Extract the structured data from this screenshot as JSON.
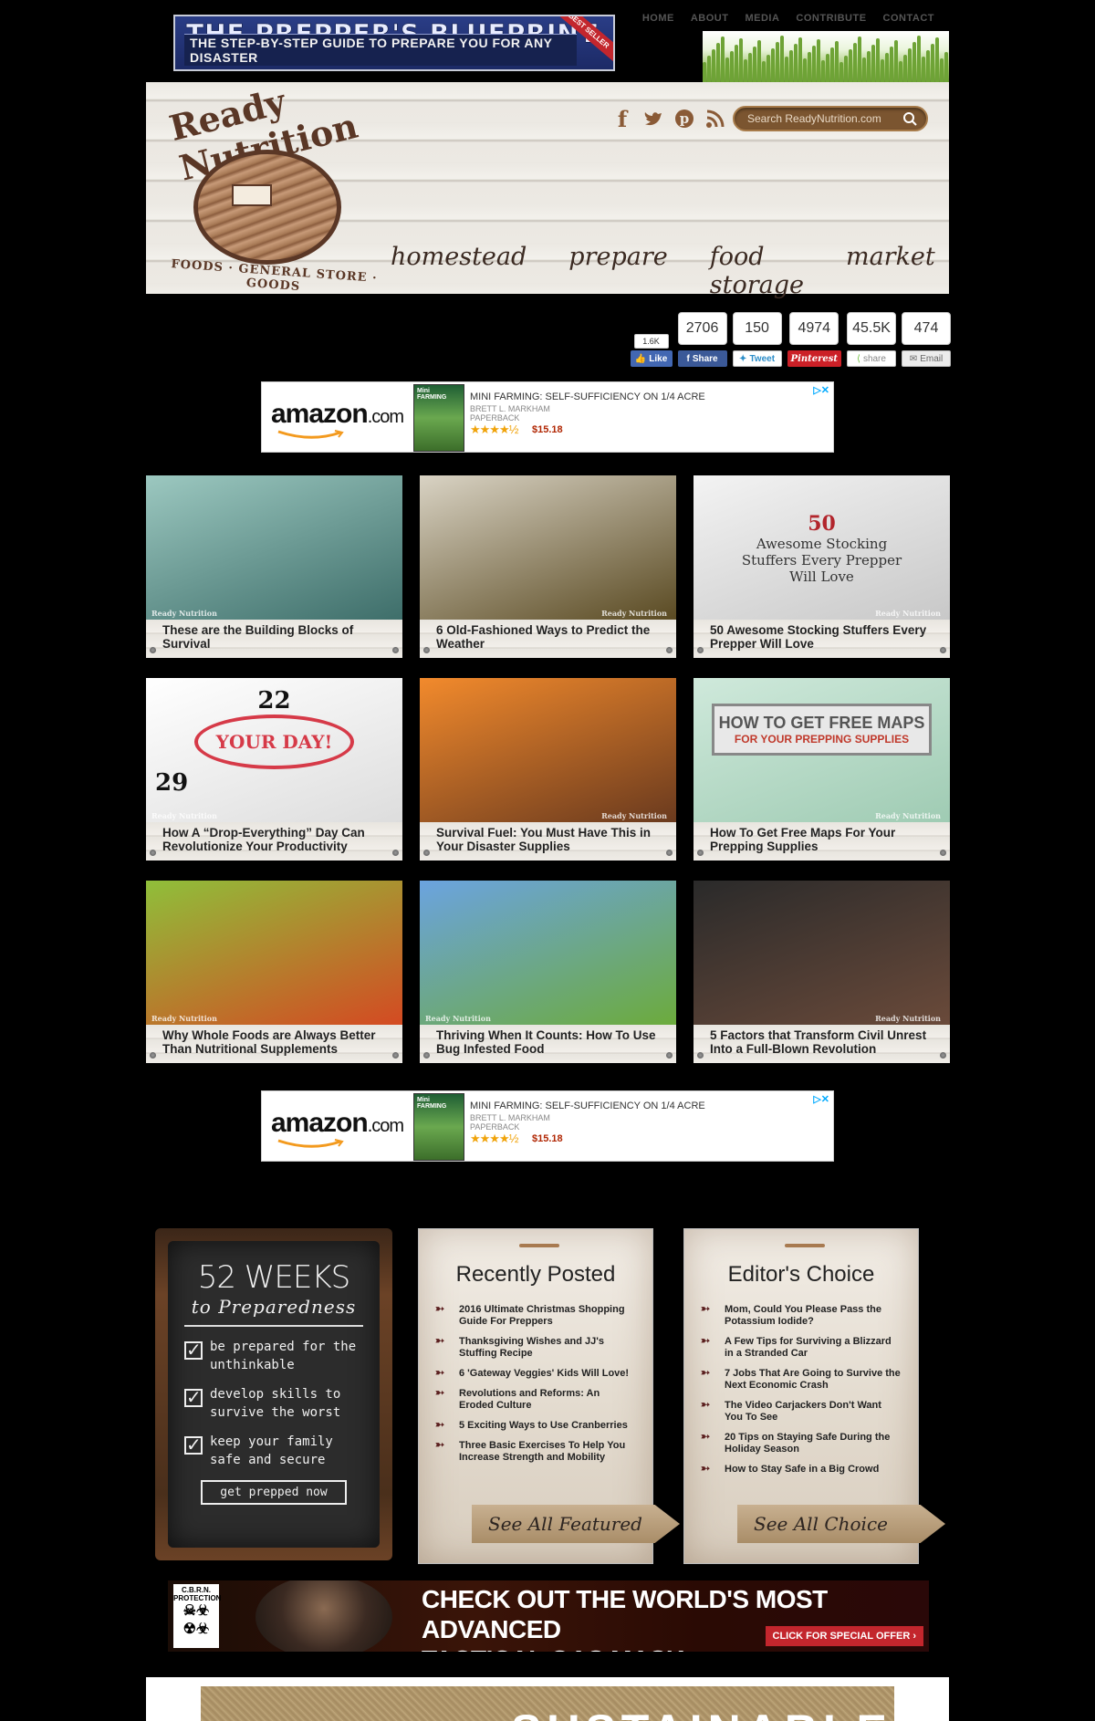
{
  "top_banner": {
    "title": "THE PREPPER'S BLUEPRINT",
    "subtitle": "THE STEP-BY-STEP GUIDE TO PREPARE YOU FOR ANY DISASTER",
    "ribbon": "BEST SELLER"
  },
  "top_nav": [
    "HOME",
    "ABOUT",
    "MEDIA",
    "CONTRIBUTE",
    "CONTACT"
  ],
  "header": {
    "logo_name": "Ready Nutrition",
    "logo_tagline": "FOODS · GENERAL STORE · GOODS",
    "social_icons": [
      "facebook-icon",
      "twitter-icon",
      "pinterest-icon",
      "rss-icon"
    ],
    "search_placeholder": "Search ReadyNutrition.com",
    "nav": [
      "homestead",
      "prepare",
      "food storage",
      "market"
    ]
  },
  "share_bar": {
    "like_count": "1.6K",
    "like_label": "Like",
    "buttons": [
      {
        "count": "2706",
        "label": "Share",
        "icon": "facebook-icon"
      },
      {
        "count": "150",
        "label": "Tweet",
        "icon": "twitter-icon"
      },
      {
        "count": "4974",
        "label": "Pinterest",
        "icon": "pinterest-icon"
      },
      {
        "count": "45.5K",
        "label": "share",
        "icon": "share-icon"
      },
      {
        "count": "474",
        "label": "Email",
        "icon": "email-icon"
      }
    ]
  },
  "amazon_ad": {
    "logo": "amazon",
    "logo_suffix": ".com",
    "book_cover_text": "Mini FARMING",
    "title": "MINI FARMING: SELF-SUFFICIENCY ON 1/4 ACRE",
    "author": "BRETT L. MARKHAM",
    "format": "PAPERBACK",
    "rating": 4.5,
    "stars": "★★★★½",
    "price": "$15.18",
    "choices_icon": "ad-choices-icon"
  },
  "watermark": "Ready Nutrition",
  "articles": [
    {
      "title": "These are the Building Blocks of Survival",
      "colors": [
        "#9cc8c0",
        "#3e6e6a"
      ]
    },
    {
      "title": "6 Old-Fashioned Ways to Predict the Weather",
      "colors": [
        "#d9d3c4",
        "#5a4a22"
      ]
    },
    {
      "title": "50 Awesome Stocking Stuffers Every Prepper Will Love",
      "colors": [
        "#f3f3f3",
        "#c8c8c8"
      ],
      "image_text_num": "50",
      "image_text": "Awesome Stocking Stuffers Every Prepper Will Love"
    },
    {
      "title": "How A “Drop-Everything” Day Can Revolutionize Your Productivity",
      "colors": [
        "#ffffff",
        "#dddddd"
      ],
      "image_text_num": "22",
      "image_text": "YOUR DAY!",
      "image_text_num2": "29"
    },
    {
      "title": "Survival Fuel: You Must Have This in Your Disaster Supplies",
      "colors": [
        "#f28a2c",
        "#6a3a1e"
      ]
    },
    {
      "title": "How To Get Free Maps For Your Prepping Supplies",
      "colors": [
        "#cfe9db",
        "#9fcbb3"
      ],
      "image_text": "HOW TO GET FREE MAPS",
      "image_text_sub": "FOR YOUR PREPPING SUPPLIES"
    },
    {
      "title": "Why Whole Foods are Always Better Than Nutritional Supplements",
      "colors": [
        "#8fbf3a",
        "#d44a22"
      ]
    },
    {
      "title": "Thriving When It Counts: How To Use Bug Infested Food",
      "colors": [
        "#6ba3e0",
        "#6cab3c"
      ]
    },
    {
      "title": "5 Factors that Transform Civil Unrest Into a Full-Blown Revolution",
      "colors": [
        "#2a2a2a",
        "#6a4a3a"
      ]
    }
  ],
  "weeks_widget": {
    "title": "52 WEEKS",
    "subtitle": "to Preparedness",
    "items": [
      "be prepared for the unthinkable",
      "develop skills to survive the worst",
      "keep your family safe and secure"
    ],
    "button": "get prepped now"
  },
  "recently_posted": {
    "heading": "Recently Posted",
    "items": [
      "2016 Ultimate Christmas Shopping Guide For Preppers",
      "Thanksgiving Wishes and JJ's Stuffing Recipe",
      "6 'Gateway Veggies' Kids Will Love!",
      "Revolutions and Reforms: An Eroded Culture",
      "5 Exciting Ways to Use Cranberries",
      "Three Basic Exercises To Help You Increase Strength and Mobility"
    ],
    "button": "See All Featured"
  },
  "editors_choice": {
    "heading": "Editor's Choice",
    "items": [
      "Mom, Could You Please Pass the Potassium Iodide?",
      "A Few Tips for Surviving a Blizzard in a Stranded Car",
      "7 Jobs That Are Going to Survive the Next Economic Crash",
      "The Video Carjackers Don't Want You To See",
      "20 Tips on Staying Safe During the Holiday Season",
      "How to Stay Safe in a Big Crowd"
    ],
    "button": "See All Choice"
  },
  "gas_banner": {
    "badge": "C.B.R.N. PROTECTION",
    "headline_line1": "CHECK OUT THE WORLD'S MOST ADVANCED",
    "headline_line2": "TACTICAL GAS MASK",
    "offer": "CLICK FOR SPECIAL OFFER"
  },
  "bottom_banner": {
    "word": "SUSTAINABLE"
  }
}
